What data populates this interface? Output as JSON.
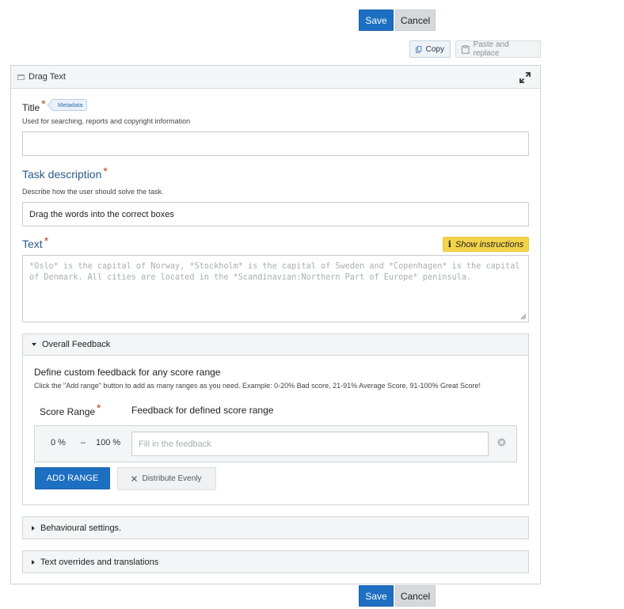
{
  "top_actions": {
    "save": "Save",
    "cancel": "Cancel"
  },
  "clipboard": {
    "copy": "Copy",
    "paste": "Paste and replace"
  },
  "editor": {
    "title": "Drag Text",
    "fields": {
      "title": {
        "label": "Title",
        "badge": "Metadata",
        "description": "Used for searching, reports and copyright information",
        "value": ""
      },
      "task": {
        "label": "Task description",
        "description": "Describe how the user should solve the task.",
        "value": "Drag the words into the correct boxes"
      },
      "text": {
        "label": "Text",
        "instructions_button": "Show instructions",
        "placeholder": "*Oslo* is the capital of Norway, *Stockholm* is the capital of Sweden and *Copenhagen* is the capital of Denmark. All cities are located in the *Scandinavian:Northern Part of Europe* peninsula."
      }
    },
    "overall_feedback": {
      "heading": "Overall Feedback",
      "title": "Define custom feedback for any score range",
      "description": "Click the \"Add range\" button to add as many ranges as you need. Example: 0-20% Bad score, 21-91% Average Score, 91-100% Great Score!",
      "col_score_range": "Score Range",
      "col_feedback": "Feedback for defined score range",
      "range": {
        "from": "0 %",
        "dash": "–",
        "to": "100 %",
        "placeholder": "Fill in the feedback"
      },
      "add_range": "ADD RANGE",
      "distribute": "Distribute Evenly"
    },
    "groups": {
      "behaviour": "Behavioural settings.",
      "overrides": "Text overrides and translations"
    }
  },
  "bottom_actions": {
    "save": "Save",
    "cancel": "Cancel"
  },
  "colors": {
    "primary": "#1d6fc1",
    "instructions": "#f3d34a",
    "required": "#c0392b",
    "label_blue": "#2b5a8c"
  }
}
